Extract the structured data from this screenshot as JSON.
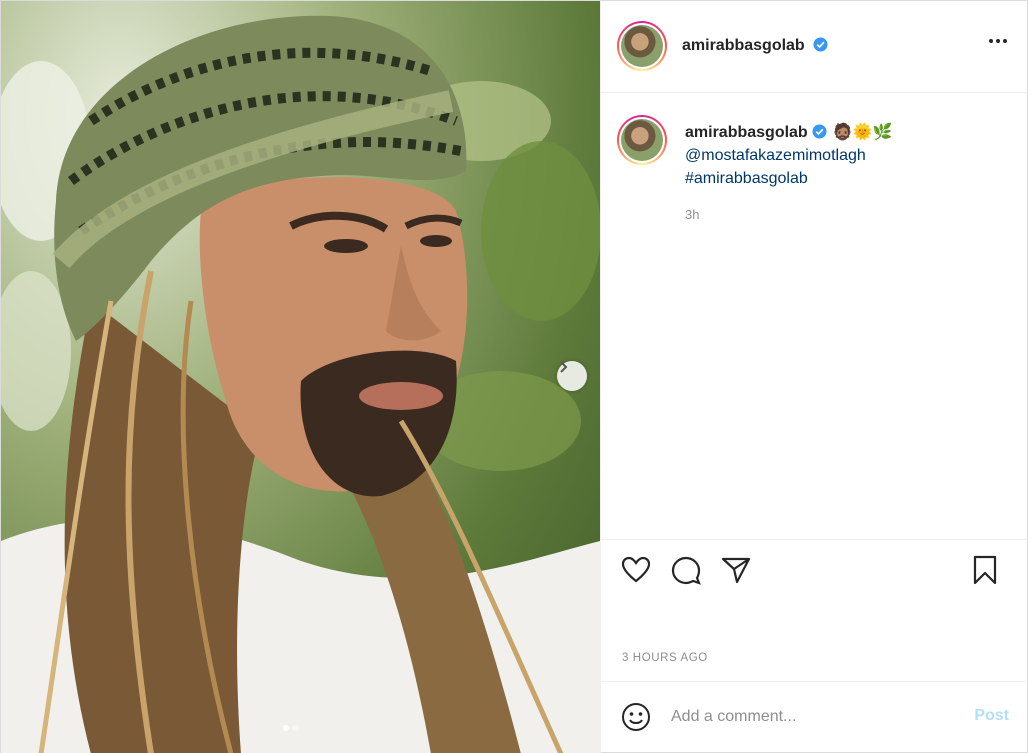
{
  "post": {
    "username": "amirabbasgolab",
    "verified": true,
    "caption_emojis": "🧔🏽🌞🌿",
    "mention": "@mostafakazemimotlagh",
    "hashtag": "#amirabbasgolab",
    "relative_time": "3h",
    "timestamp": "3 HOURS AGO"
  },
  "add_comment": {
    "placeholder": "Add a comment...",
    "post_label": "Post"
  },
  "icons": {
    "more": "more-options-icon",
    "next": "chevron-right-icon",
    "like": "heart-icon",
    "comment": "comment-bubble-icon",
    "share": "paper-plane-icon",
    "save": "bookmark-icon",
    "emoji": "smiley-icon",
    "verified": "verified-badge-icon"
  },
  "carousel": {
    "slide_count": 2,
    "active_slide": 1
  },
  "colors": {
    "link": "#00376b",
    "verified": "#3897f0",
    "post_disabled": "#b2dffc",
    "muted": "#8e8e8e"
  }
}
